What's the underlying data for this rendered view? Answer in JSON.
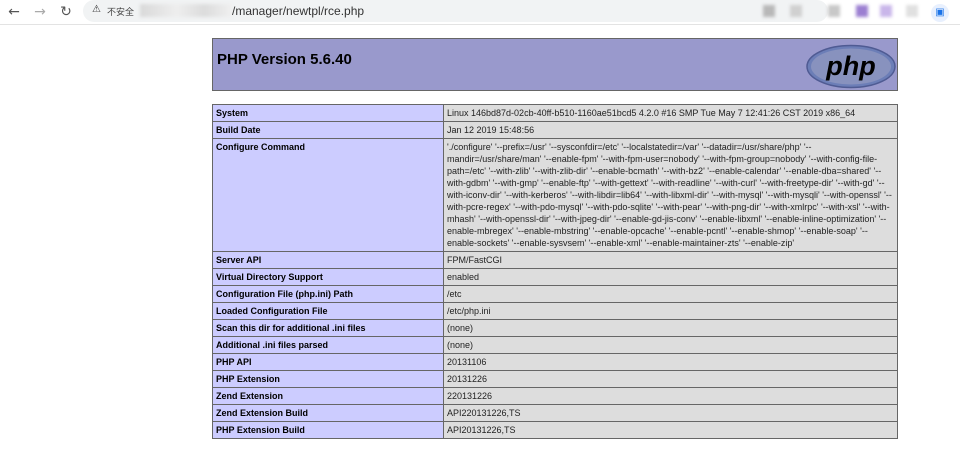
{
  "browser": {
    "insecure_label": "不安全",
    "url_path": "/manager/newtpl/rce.php"
  },
  "page": {
    "title": "PHP Version 5.6.40",
    "logo_text": "php",
    "rows": [
      {
        "label": "System",
        "value": "Linux 146bd87d-02cb-40ff-b510-1160ae51bcd5 4.2.0 #16 SMP Tue May 7 12:41:26 CST 2019 x86_64"
      },
      {
        "label": "Build Date",
        "value": "Jan 12 2019 15:48:56"
      },
      {
        "label": "Configure Command",
        "value": "'./configure' '--prefix=/usr' '--sysconfdir=/etc' '--localstatedir=/var' '--datadir=/usr/share/php' '--mandir=/usr/share/man' '--enable-fpm' '--with-fpm-user=nobody' '--with-fpm-group=nobody' '--with-config-file-path=/etc' '--with-zlib' '--with-zlib-dir' '--enable-bcmath' '--with-bz2' '--enable-calendar' '--enable-dba=shared' '--with-gdbm' '--with-gmp' '--enable-ftp' '--with-gettext' '--with-readline' '--with-curl' '--with-freetype-dir' '--with-gd' '--with-iconv-dir' '--with-kerberos' '--with-libdir=lib64' '--with-libxml-dir' '--with-mysql' '--with-mysqli' '--with-openssl' '--with-pcre-regex' '--with-pdo-mysql' '--with-pdo-sqlite' '--with-pear' '--with-png-dir' '--with-xmlrpc' '--with-xsl' '--with-mhash' '--with-openssl-dir' '--with-jpeg-dir' '--enable-gd-jis-conv' '--enable-libxml' '--enable-inline-optimization' '--enable-mbregex' '--enable-mbstring' '--enable-opcache' '--enable-pcntl' '--enable-shmop' '--enable-soap' '--enable-sockets' '--enable-sysvsem' '--enable-xml' '--enable-maintainer-zts' '--enable-zip'"
      },
      {
        "label": "Server API",
        "value": "FPM/FastCGI"
      },
      {
        "label": "Virtual Directory Support",
        "value": "enabled"
      },
      {
        "label": "Configuration File (php.ini) Path",
        "value": "/etc"
      },
      {
        "label": "Loaded Configuration File",
        "value": "/etc/php.ini"
      },
      {
        "label": "Scan this dir for additional .ini files",
        "value": "(none)"
      },
      {
        "label": "Additional .ini files parsed",
        "value": "(none)"
      },
      {
        "label": "PHP API",
        "value": "20131106"
      },
      {
        "label": "PHP Extension",
        "value": "20131226"
      },
      {
        "label": "Zend Extension",
        "value": "220131226"
      },
      {
        "label": "Zend Extension Build",
        "value": "API220131226,TS"
      },
      {
        "label": "PHP Extension Build",
        "value": "API20131226,TS"
      }
    ]
  },
  "colors": {
    "header_bg": "#9999cc",
    "label_bg": "#ccccff",
    "value_bg": "#dddddd",
    "border": "#666666"
  }
}
